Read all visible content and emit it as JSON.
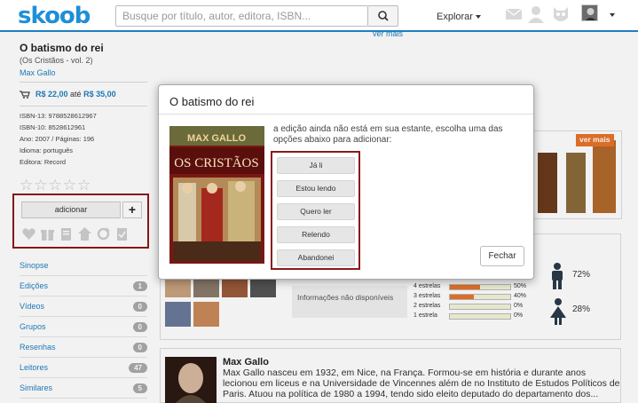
{
  "header": {
    "logo": "skoob",
    "search_placeholder": "Busque por título, autor, editora, ISBN...",
    "explore_label": "Explorar"
  },
  "top_link": "ver mais",
  "book": {
    "title": "O batismo do rei",
    "series": "(Os Cristãos - vol. 2)",
    "author": "Max Gallo",
    "price_low": "R$ 22,00",
    "price_sep": "até",
    "price_high": "R$ 35,00",
    "meta": [
      "ISBN-13: 9788528612967",
      "ISBN-10: 8528612961",
      "Ano: 2007 / Páginas: 196",
      "Idioma: português",
      "Editora: Record"
    ]
  },
  "add": {
    "label": "adicionar",
    "plus": "+"
  },
  "menu": [
    {
      "label": "Sinopse",
      "count": ""
    },
    {
      "label": "Edições",
      "count": "1"
    },
    {
      "label": "Vídeos",
      "count": "0"
    },
    {
      "label": "Grupos",
      "count": "0"
    },
    {
      "label": "Resenhas",
      "count": "0"
    },
    {
      "label": "Leitores",
      "count": "47"
    },
    {
      "label": "Similares",
      "count": "5"
    }
  ],
  "ratings": {
    "info_unavailable": "Informações não disponíveis",
    "rows": [
      {
        "label": "4 estrelas",
        "percent": 50,
        "percent_label": "50%"
      },
      {
        "label": "3 estrelas",
        "percent": 40,
        "percent_label": "40%"
      },
      {
        "label": "2 estrelas",
        "percent": 0,
        "percent_label": "0%"
      },
      {
        "label": "1 estrela",
        "percent": 0,
        "percent_label": "0%"
      }
    ],
    "male_percent": "72%",
    "female_percent": "28%"
  },
  "related": {
    "more_label": "ver mais"
  },
  "author_section": {
    "name": "Max Gallo",
    "bio": "Max Gallo nasceu em 1932, em Nice, na França. Formou-se em história e durante anos lecionou em liceus e na Universidade de Vincennes além de no Instituto de Estudos Políticos de Paris. Atuou na política de 1980 a 1994, tendo sido eleito deputado do departamento dos..."
  },
  "modal": {
    "title": "O batismo do rei",
    "message": "a edição ainda não está em sua estante, escolha uma das opções abaixo para adicionar:",
    "cover_author": "MAX GALLO",
    "cover_title": "OS CRISTÃOS",
    "options": [
      "Já li",
      "Estou lendo",
      "Quero ler",
      "Relendo",
      "Abandonei"
    ],
    "close_label": "Fechar"
  },
  "colors": {
    "brand": "#1f8fd6",
    "highlight_border": "#8b1a1a",
    "accent": "#e8732a"
  }
}
